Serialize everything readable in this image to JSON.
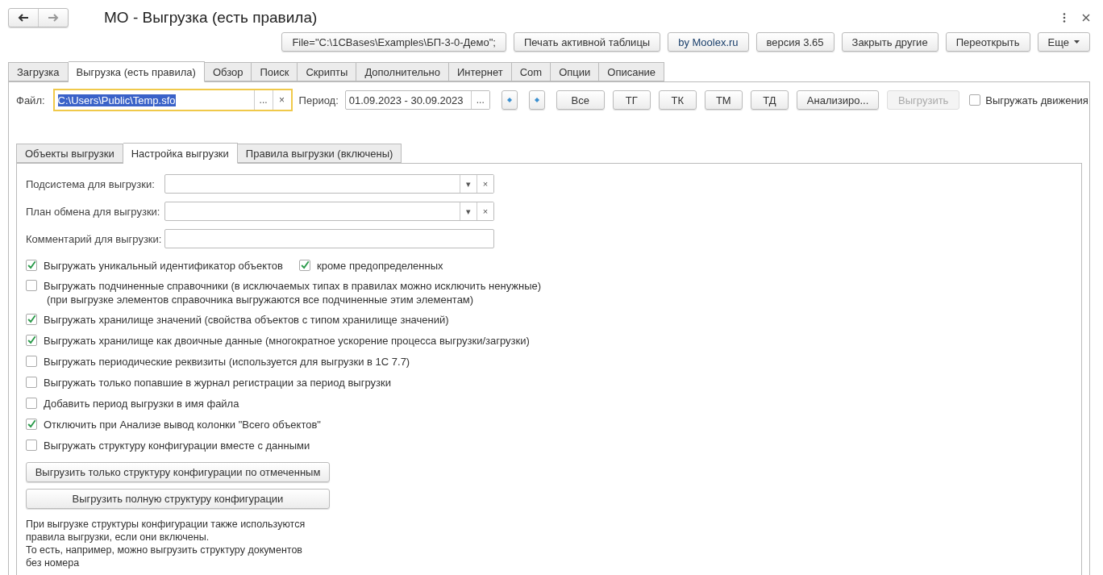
{
  "window": {
    "title": "МО - Выгрузка (есть правила)"
  },
  "commands": [
    {
      "label": "File=\"C:\\1CBases\\Examples\\БП-3-0-Демо\";",
      "kind": "plain"
    },
    {
      "label": "Печать активной таблицы",
      "kind": "plain"
    },
    {
      "label": "by Moolex.ru",
      "kind": "link"
    },
    {
      "label": "версия 3.65",
      "kind": "plain"
    },
    {
      "label": "Закрыть другие",
      "kind": "plain"
    },
    {
      "label": "Переоткрыть",
      "kind": "plain"
    },
    {
      "label": "Еще",
      "kind": "menu"
    }
  ],
  "tabs": [
    {
      "label": "Загрузка",
      "selected": false
    },
    {
      "label": "Выгрузка (есть правила)",
      "selected": true
    },
    {
      "label": "Обзор",
      "selected": false
    },
    {
      "label": "Поиск",
      "selected": false
    },
    {
      "label": "Скрипты",
      "selected": false
    },
    {
      "label": "Дополнительно",
      "selected": false
    },
    {
      "label": "Интернет",
      "selected": false
    },
    {
      "label": "Com",
      "selected": false
    },
    {
      "label": "Опции",
      "selected": false
    },
    {
      "label": "Описание",
      "selected": false
    }
  ],
  "file": {
    "label": "Файл:",
    "value": "C:\\Users\\Public\\Temp.sfo",
    "choose": "...",
    "clear": "×"
  },
  "period": {
    "label": "Период:",
    "value": "01.09.2023 - 30.09.2023",
    "choose": "..."
  },
  "actions": [
    {
      "label": "Все",
      "disabled": false
    },
    {
      "label": "ТГ",
      "disabled": false
    },
    {
      "label": "ТК",
      "disabled": false
    },
    {
      "label": "ТМ",
      "disabled": false
    },
    {
      "label": "ТД",
      "disabled": false
    },
    {
      "label": "Анализиро...",
      "disabled": false
    },
    {
      "label": "Выгрузить",
      "disabled": true
    }
  ],
  "export_movements": {
    "label": "Выгружать движения",
    "checked": false
  },
  "subtabs": [
    {
      "label": "Объекты выгрузки",
      "selected": false
    },
    {
      "label": "Настройка выгрузки",
      "selected": true
    },
    {
      "label": "Правила выгрузки (включены)",
      "selected": false
    }
  ],
  "fields": [
    {
      "label": "Подсистема для выгрузки:",
      "kind": "select",
      "dropdown": "▾",
      "clear": "×"
    },
    {
      "label": "План обмена для выгрузки:",
      "kind": "select",
      "dropdown": "▾",
      "clear": "×"
    },
    {
      "label": "Комментарий для выгрузки:",
      "kind": "text"
    }
  ],
  "options": [
    {
      "label": "Выгружать уникальный идентификатор объектов",
      "checked": true,
      "extra": {
        "label": "кроме предопределенных",
        "checked": true
      }
    },
    {
      "label": "Выгружать подчиненные справочники (в исключаемых типах в правилах можно исключить ненужные)",
      "note": "(при выгрузке элементов справочника выгружаются все подчиненные этим элементам)",
      "checked": false
    },
    {
      "label": "Выгружать хранилище значений (свойства объектов с типом хранилище значений)",
      "checked": true
    },
    {
      "label": "Выгружать хранилище как двоичные данные (многократное ускорение процесса выгрузки/загрузки)",
      "checked": true
    },
    {
      "label": "Выгружать периодические реквизиты (используется для выгрузки в 1С 7.7)",
      "checked": false
    },
    {
      "label": "Выгружать только попавшие в журнал регистрации за период выгрузки",
      "checked": false
    },
    {
      "label": "Добавить период выгрузки в имя файла",
      "checked": false
    },
    {
      "label": "Отключить при Анализе вывод колонки \"Всего объектов\"",
      "checked": true
    },
    {
      "label": "Выгружать структуру конфигурации вместе с данными",
      "checked": false
    }
  ],
  "structure_buttons": [
    "Выгрузить только структуру конфигурации по отмеченным",
    "Выгрузить полную структуру конфигурации"
  ],
  "info_lines": [
    "При выгрузке структуры конфигурации также используются",
    "правила выгрузки, если они включены.",
    "То есть, например, можно выгрузить структуру документов",
    "без номера"
  ]
}
